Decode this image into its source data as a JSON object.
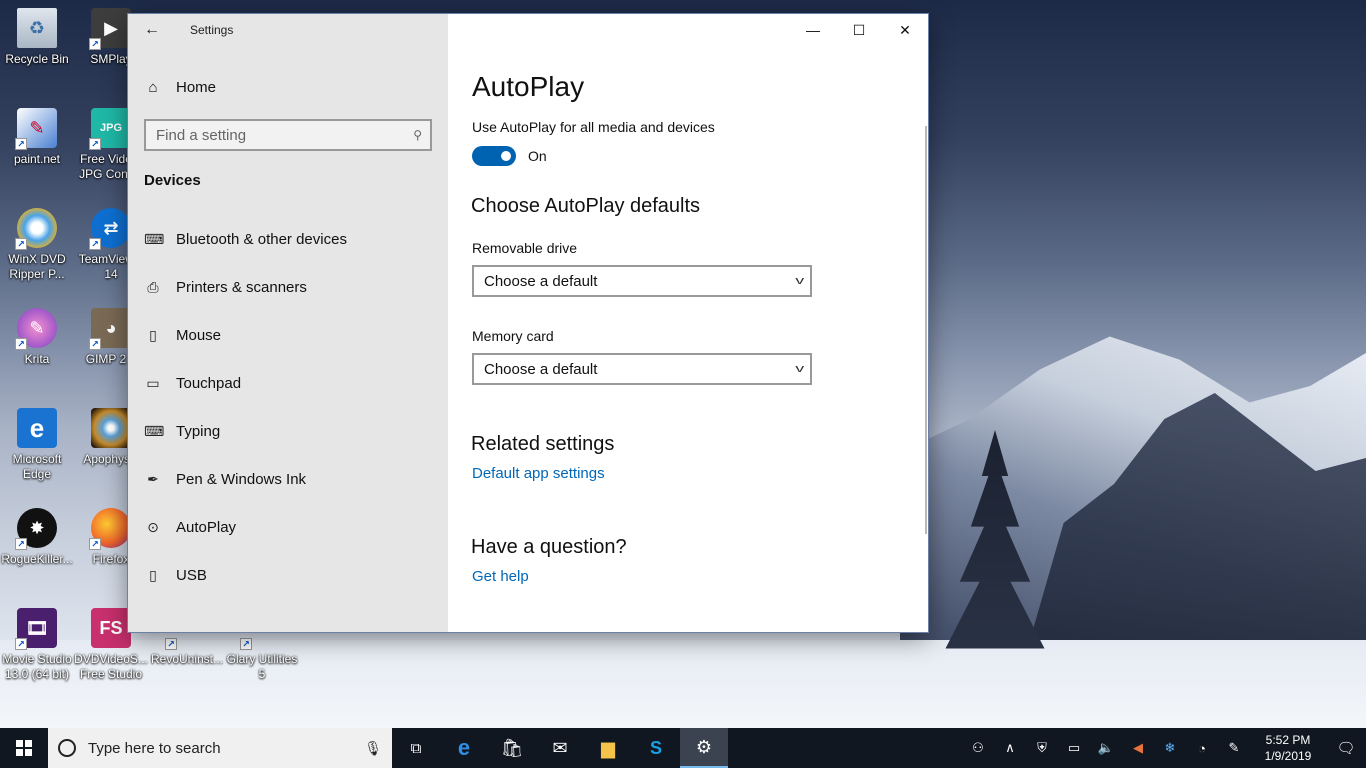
{
  "desktop": {
    "icons": [
      {
        "label": "Recycle Bin",
        "icon": "recycle-bin-icon"
      },
      {
        "label": "SMPlay",
        "icon": "smplayer-icon"
      },
      {
        "label": "paint.net",
        "icon": "paint-net-icon"
      },
      {
        "label": "Free Vide... JPG Conv...",
        "icon": "video-to-jpg-icon"
      },
      {
        "label": "WinX DVD Ripper P...",
        "icon": "winx-dvd-icon"
      },
      {
        "label": "TeamView... 14",
        "icon": "teamviewer-icon"
      },
      {
        "label": "Krita",
        "icon": "krita-icon"
      },
      {
        "label": "GIMP 2.1",
        "icon": "gimp-icon"
      },
      {
        "label": "Microsoft Edge",
        "icon": "edge-icon"
      },
      {
        "label": "Apophysis",
        "icon": "apophysis-icon"
      },
      {
        "label": "RogueKiller...",
        "icon": "roguekiller-icon"
      },
      {
        "label": "Firefox",
        "icon": "firefox-icon"
      },
      {
        "label": "Movie Studio 13.0 (64 bit)",
        "icon": "movie-studio-icon"
      },
      {
        "label": "DVDVideoS... Free Studio",
        "icon": "dvdvideosoft-icon"
      },
      {
        "label": "RevoUninst...",
        "icon": "revo-uninstaller-icon"
      },
      {
        "label": "Glary Utilities 5",
        "icon": "glary-utilities-icon"
      }
    ]
  },
  "window": {
    "title": "Settings",
    "sidebar": {
      "home_label": "Home",
      "search_placeholder": "Find a setting",
      "section_title": "Devices",
      "items": [
        {
          "label": "Bluetooth & other devices",
          "icon": "bluetooth-devices-icon"
        },
        {
          "label": "Printers & scanners",
          "icon": "printer-icon"
        },
        {
          "label": "Mouse",
          "icon": "mouse-icon"
        },
        {
          "label": "Touchpad",
          "icon": "touchpad-icon"
        },
        {
          "label": "Typing",
          "icon": "keyboard-icon"
        },
        {
          "label": "Pen & Windows Ink",
          "icon": "pen-icon"
        },
        {
          "label": "AutoPlay",
          "icon": "autoplay-icon"
        },
        {
          "label": "USB",
          "icon": "usb-icon"
        }
      ]
    },
    "content": {
      "page_title": "AutoPlay",
      "toggle_label": "Use AutoPlay for all media and devices",
      "toggle_state": "On",
      "defaults_heading": "Choose AutoPlay defaults",
      "removable_label": "Removable drive",
      "removable_value": "Choose a default",
      "memory_label": "Memory card",
      "memory_value": "Choose a default",
      "related_heading": "Related settings",
      "related_link": "Default app settings",
      "question_heading": "Have a question?",
      "help_link": "Get help"
    }
  },
  "taskbar": {
    "search_placeholder": "Type here to search",
    "apps": [
      "task-view-icon",
      "edge-icon",
      "store-icon",
      "mail-icon",
      "file-explorer-icon",
      "skype-icon",
      "settings-icon"
    ],
    "time": "5:52 PM",
    "date": "1/9/2019"
  }
}
